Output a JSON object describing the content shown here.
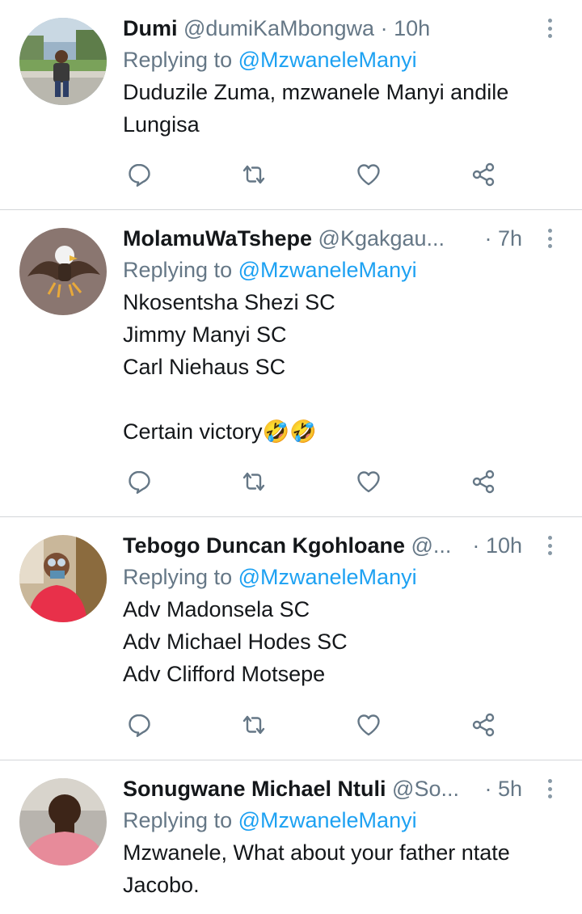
{
  "tweets": [
    {
      "name": "Dumi",
      "handle": "@dumiKaMbongwa",
      "separator": "·",
      "time": "10h",
      "replying_prefix": "Replying to ",
      "replying_to": "@MzwaneleManyi",
      "text": "Duduzile Zuma, mzwanele Manyi andile\nLungisa",
      "avatar": "avatar-man-park"
    },
    {
      "name": "MolamuWaTshepe",
      "handle": "@Kgakgau...",
      "separator": "·",
      "time": "7h",
      "replying_prefix": "Replying to ",
      "replying_to": "@MzwaneleManyi",
      "text": "Nkosentsha Shezi SC\nJimmy Manyi SC\nCarl Niehaus SC\n\nCertain victory🤣🤣",
      "avatar": "avatar-eagle"
    },
    {
      "name": "Tebogo Duncan Kgohloane",
      "handle": "@...",
      "separator": "·",
      "time": "10h",
      "replying_prefix": "Replying to ",
      "replying_to": "@MzwaneleManyi",
      "text": "Adv Madonsela SC\nAdv Michael Hodes SC\nAdv Clifford Motsepe",
      "avatar": "avatar-person-red"
    },
    {
      "name": "Sonugwane Michael Ntuli",
      "handle": "@So...",
      "separator": "·",
      "time": "5h",
      "replying_prefix": "Replying to ",
      "replying_to": "@MzwaneleManyi",
      "text": "Mzwanele, What about your father ntate\nJacobo.",
      "avatar": "avatar-man-pink"
    }
  ],
  "icons": {
    "reply": "reply-icon",
    "retweet": "retweet-icon",
    "like": "like-icon",
    "share": "share-icon",
    "more": "more-options-icon"
  },
  "colors": {
    "text": "#14171a",
    "secondary": "#657786",
    "mention": "#1da1f2",
    "icon": "#657786",
    "divider": "#d3d6d9"
  }
}
